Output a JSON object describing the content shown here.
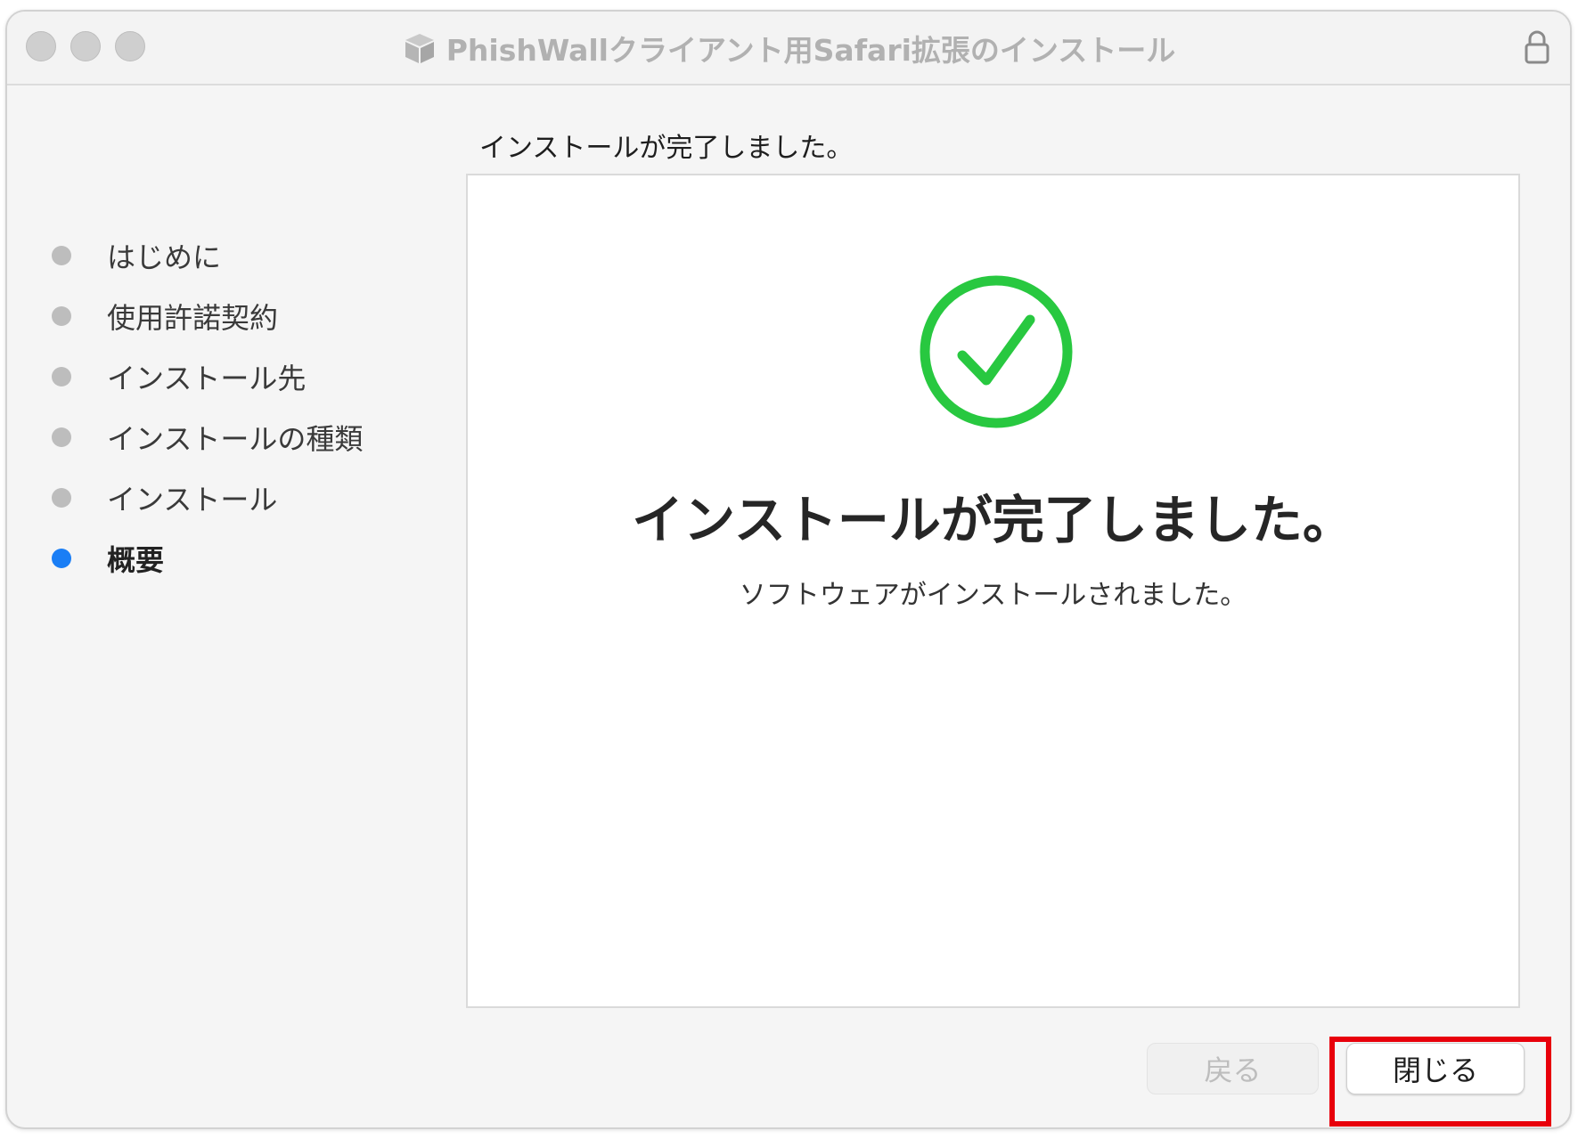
{
  "window": {
    "title": "PhishWallクライアント用Safari拡張のインストール"
  },
  "sidebar": {
    "steps": [
      {
        "label": "はじめに",
        "active": false
      },
      {
        "label": "使用許諾契約",
        "active": false
      },
      {
        "label": "インストール先",
        "active": false
      },
      {
        "label": "インストールの種類",
        "active": false
      },
      {
        "label": "インストール",
        "active": false
      },
      {
        "label": "概要",
        "active": true
      }
    ]
  },
  "main": {
    "heading": "インストールが完了しました。",
    "status_icon": "checkmark-circle-icon",
    "message": "インストールが完了しました。",
    "submessage": "ソフトウェアがインストールされました。"
  },
  "buttons": {
    "back_label": "戻る",
    "close_label": "閉じる"
  },
  "colors": {
    "accent": "#1a7ef5",
    "success": "#28c840",
    "highlight": "#e8000b"
  }
}
